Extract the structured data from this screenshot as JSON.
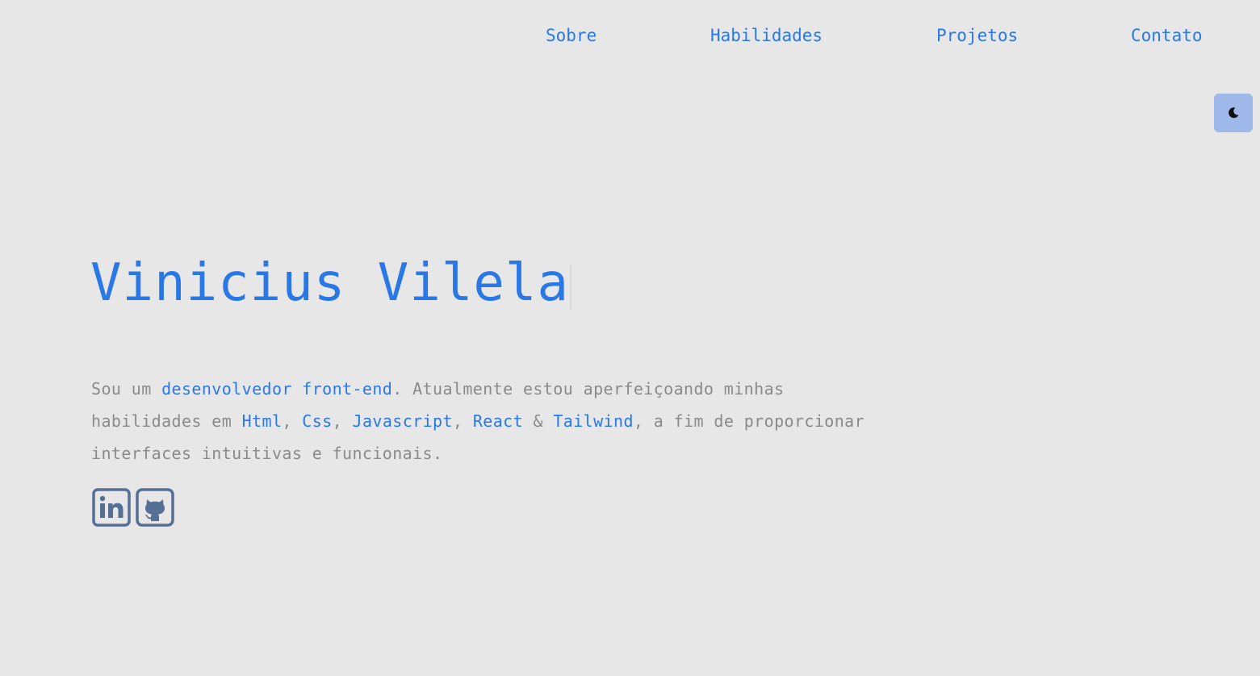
{
  "nav": {
    "items": [
      {
        "label": "Sobre"
      },
      {
        "label": "Habilidades"
      },
      {
        "label": "Projetos"
      },
      {
        "label": "Contato"
      }
    ]
  },
  "theme_toggle": {
    "icon": "moon-icon"
  },
  "hero": {
    "title": "Vinicius Vilela",
    "intro": {
      "t1": "Sou um ",
      "h1": "desenvolvedor front-end",
      "t2": ". Atualmente estou aperfeiçoando minhas habilidades em ",
      "h2": "Html",
      "t3": ", ",
      "h3": "Css",
      "t4": ", ",
      "h4": "Javascript",
      "t5": ", ",
      "h5": "React",
      "t6": " & ",
      "h6": "Tailwind",
      "t7": ", a fim de proporcionar interfaces intuitivas e funcionais."
    }
  },
  "socials": [
    {
      "icon": "linkedin-icon"
    },
    {
      "icon": "github-icon"
    }
  ],
  "colors": {
    "background": "#e7e7e7",
    "accent": "#2a78e6",
    "muted_text": "#8a8a8a",
    "icon": "#566f95",
    "toggle_bg": "#9fb9ea"
  }
}
